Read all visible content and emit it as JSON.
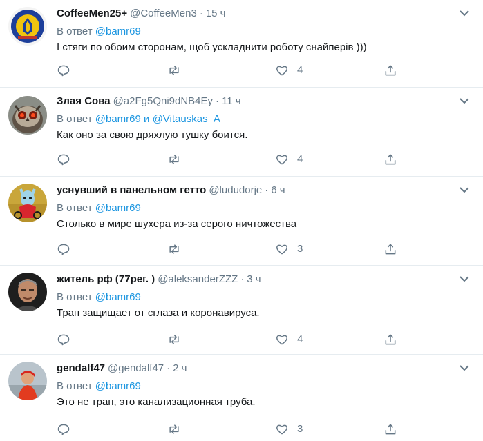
{
  "reply_prefix": "В ответ",
  "reply_joiner": "и",
  "tweets": [
    {
      "name": "CoffeeMen25+",
      "handle": "@CoffeeMen3",
      "time": "15 ч",
      "reply_to": [
        "@bamr69"
      ],
      "text": "І стяги по обоим сторонам, щоб ускладнити роботу снайперів )))",
      "likes": "4",
      "avatar": "ukraine-flag-emblem"
    },
    {
      "name": "Злая Сова",
      "handle": "@a2Fg5Qni9dNB4Ey",
      "time": "11 ч",
      "reply_to": [
        "@bamr69",
        "@Vitauskas_A"
      ],
      "text": "Как оно за свою дряхлую тушку боится.",
      "likes": "4",
      "avatar": "owl"
    },
    {
      "name": "уснувший в панельном гетто",
      "handle": "@lududorje",
      "time": "6 ч",
      "reply_to": [
        "@bamr69"
      ],
      "text": "Столько в мире шухера из-за серого ничтожества",
      "likes": "3",
      "avatar": "cartoon-character"
    },
    {
      "name": "житель рф (77рег. )",
      "handle": "@aleksanderZZZ",
      "time": "3 ч",
      "reply_to": [
        "@bamr69"
      ],
      "text": "Трап защищает от сглаза и коронавируса.",
      "likes": "4",
      "avatar": "man-portrait"
    },
    {
      "name": "gendalf47",
      "handle": "@gendalf47",
      "time": "2 ч",
      "reply_to": [
        "@bamr69"
      ],
      "text": "Это не трап, это канализационная труба.",
      "likes": "3",
      "avatar": "person-outdoors"
    }
  ]
}
